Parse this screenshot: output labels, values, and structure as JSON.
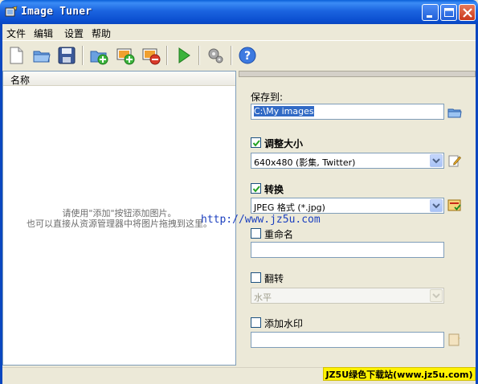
{
  "window": {
    "title": "Image Tuner"
  },
  "menu": [
    "文件",
    "编辑",
    "设置",
    "帮助"
  ],
  "toolbar": {
    "buttons": [
      "new-icon",
      "open-folder-icon",
      "save-icon",
      "add-folder-icon",
      "add-images-icon",
      "remove-images-icon",
      "run-icon",
      "settings-icon",
      "help-icon"
    ]
  },
  "list": {
    "column_header": "名称",
    "hint_line1": "请使用\"添加\"按钮添加图片。",
    "hint_line2": "也可以直接从资源管理器中将图片拖拽到这里。"
  },
  "overlay": {
    "url": "http://www.jz5u.com",
    "stamp": "JZ5U绿色下载站(www.jz5u.com)"
  },
  "options": {
    "save_to_label": "保存到:",
    "save_to_value": "C:\\My images",
    "resize_label": "调整大小",
    "resize_checked": true,
    "resize_value": "640x480 (影集, Twitter)",
    "convert_label": "转换",
    "convert_checked": true,
    "convert_value": "JPEG 格式 (*.jpg)",
    "rename_label": "重命名",
    "rename_checked": false,
    "rename_value": "",
    "flip_label": "翻转",
    "flip_checked": false,
    "flip_value": "水平",
    "watermark_label": "添加水印",
    "watermark_checked": false,
    "watermark_value": ""
  }
}
